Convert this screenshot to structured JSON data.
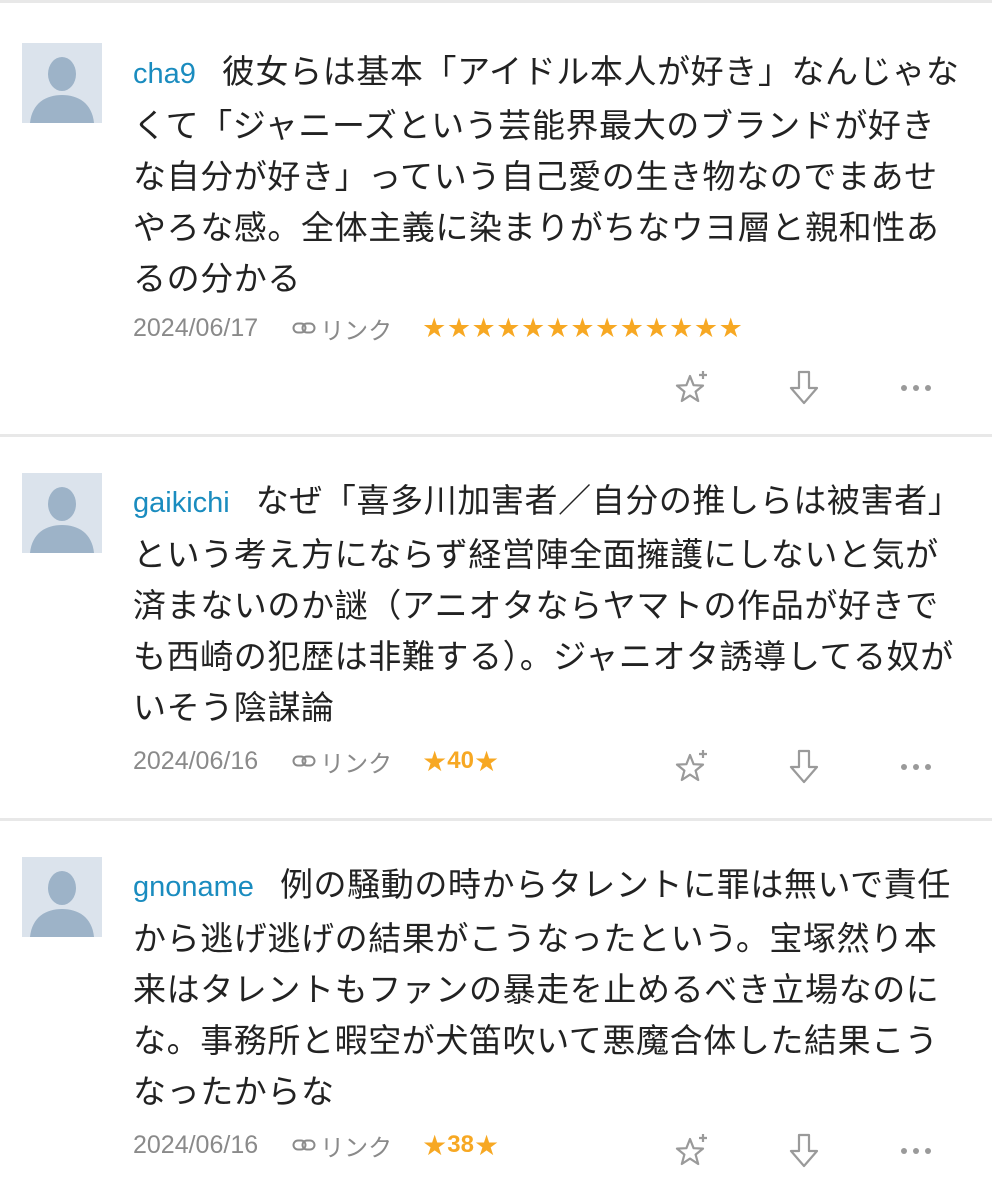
{
  "comments": [
    {
      "username": "cha9",
      "body": "彼女らは基本「アイドル本人が好き」なんじゃなくて「ジャニーズという芸能界最大のブランドが好きな自分が好き」っていう自己愛の生き物なのでまあせやろな感。全体主義に染まりがちなウヨ層と親和性あるの分かる",
      "date": "2024/06/17",
      "link_label": "リンク",
      "rating_stars": "★★★★★★★★★★★★★",
      "rating_count": 13
    },
    {
      "username": "gaikichi",
      "body": "なぜ「喜多川加害者／自分の推しらは被害者」という考え方にならず経営陣全面擁護にしないと気が済まないのか謎（アニオタならヤマトの作品が好きでも西崎の犯歴は非難する）。ジャニオタ誘導してる奴がいそう陰謀論",
      "date": "2024/06/16",
      "link_label": "リンク",
      "score": "40"
    },
    {
      "username": "gnoname",
      "body": "例の騒動の時からタレントに罪は無いで責任から逃げ逃げの結果がこうなったという。宝塚然り本来はタレントもファンの暴走を止めるべき立場なのにな。事務所と暇空が犬笛吹いて悪魔合体した結果こうなったからな",
      "date": "2024/06/16",
      "link_label": "リンク",
      "score": "38"
    }
  ],
  "icons": {
    "avatar": "default-user-silhouette",
    "link": "chain-link-icon",
    "add_star": "star-plus-icon",
    "downvote": "arrow-down-icon",
    "more": "ellipsis-icon"
  },
  "colors": {
    "username": "#1a8cbf",
    "star": "#f7a823",
    "meta": "#8a8a8a",
    "icon": "#9a9a9a",
    "avatar_bg": "#dbe3ec",
    "avatar_fg": "#9db3c8",
    "divider": "#e8e8e8"
  }
}
